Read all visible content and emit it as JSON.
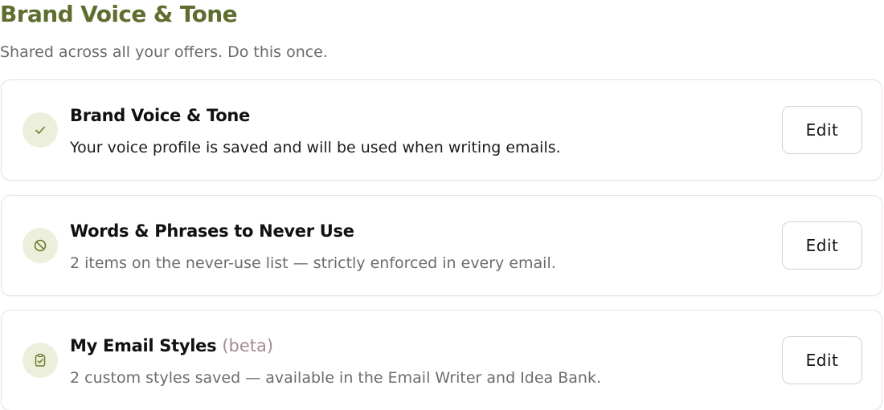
{
  "header": {
    "title": "Brand Voice & Tone",
    "subtitle": "Shared across all your offers. Do this once."
  },
  "colors": {
    "title_green": "#5f6d2f",
    "icon_bg": "#ecefdc",
    "icon_stroke": "#6b7a2a",
    "beta_mauve": "#a48a93",
    "card_border": "#ecdfe0"
  },
  "cards": [
    {
      "icon": "check-icon",
      "title": "Brand Voice & Tone",
      "description": "Your voice profile is saved and will be used when writing emails.",
      "button_label": "Edit"
    },
    {
      "icon": "ban-icon",
      "title": "Words & Phrases to Never Use",
      "description": "2 items on the never-use list — strictly enforced in every email.",
      "button_label": "Edit"
    },
    {
      "icon": "clipboard-check-icon",
      "title": "My Email Styles",
      "badge": "(beta)",
      "description": "2 custom styles saved — available in the Email Writer and Idea Bank.",
      "button_label": "Edit"
    }
  ]
}
